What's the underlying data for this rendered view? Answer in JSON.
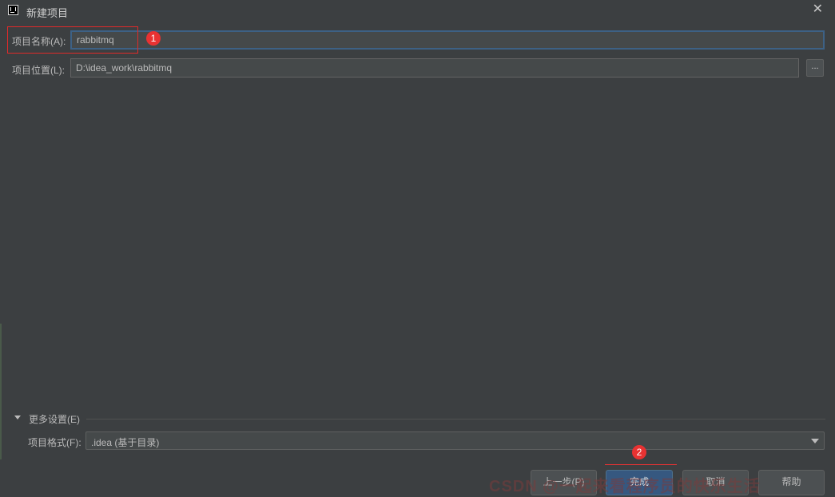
{
  "window": {
    "title": "新建项目",
    "close_symbol": "✕"
  },
  "form": {
    "name_label": "项目名称(A):",
    "name_value": "rabbitmq",
    "location_label": "项目位置(L):",
    "location_value": "D:\\idea_work\\rabbitmq",
    "browse_label": "..."
  },
  "annotations": {
    "badge1": "1",
    "badge2": "2"
  },
  "more_settings": {
    "label": "更多设置(E)",
    "format_label": "项目格式(F):",
    "format_value": ".idea (基于目录)"
  },
  "buttons": {
    "previous": "上一步(P)",
    "finish": "完成",
    "cancel": "取消",
    "help": "帮助"
  },
  "watermark": "CSDN @一起来看程序员的快乐生活",
  "colors": {
    "background": "#3c3f41",
    "accent": "#365880",
    "annotation_red": "#e83232"
  }
}
